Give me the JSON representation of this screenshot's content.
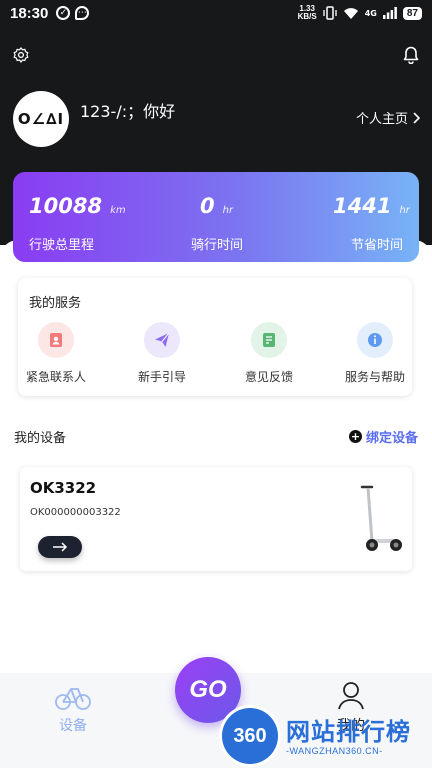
{
  "status_bar": {
    "time": "18:30",
    "net_speed_value": "1.33",
    "net_speed_unit": "KB/S",
    "network": "4G",
    "battery": "87"
  },
  "header": {
    "settings_icon": "gear-icon",
    "bell_icon": "bell-icon",
    "avatar_text": "O∠∆I",
    "username": "123-/:；你好",
    "profile_link": "个人主页"
  },
  "stats": {
    "items": [
      {
        "value": "10088",
        "unit": "km",
        "label": "行驶总里程"
      },
      {
        "value": "0",
        "unit": "hr",
        "label": "骑行时间"
      },
      {
        "value": "1441",
        "unit": "hr",
        "label": "节省时间"
      }
    ],
    "gradient_start": "#8a3cf2",
    "gradient_end": "#78b3f6"
  },
  "services": {
    "title": "我的服务",
    "items": [
      {
        "label": "紧急联系人",
        "icon": "contact-card-icon",
        "bg": "#fde6e6",
        "color": "#f27a7a"
      },
      {
        "label": "新手引导",
        "icon": "paper-plane-icon",
        "bg": "#ece7fb",
        "color": "#8e6cf0"
      },
      {
        "label": "意见反馈",
        "icon": "feedback-note-icon",
        "bg": "#e2f3e7",
        "color": "#59b574"
      },
      {
        "label": "服务与帮助",
        "icon": "info-icon",
        "bg": "#e3eefc",
        "color": "#5d9af0"
      }
    ]
  },
  "devices": {
    "title": "我的设备",
    "bind_label": "绑定设备",
    "device": {
      "name": "OK3322",
      "serial": "OK000000003322"
    }
  },
  "bottom_nav": {
    "left_label": "设备",
    "center_label": "GO",
    "right_label": "我的"
  },
  "watermark": {
    "logo": "360",
    "title": "网站排行榜",
    "url": "-WANGZHAN360.CN-"
  }
}
